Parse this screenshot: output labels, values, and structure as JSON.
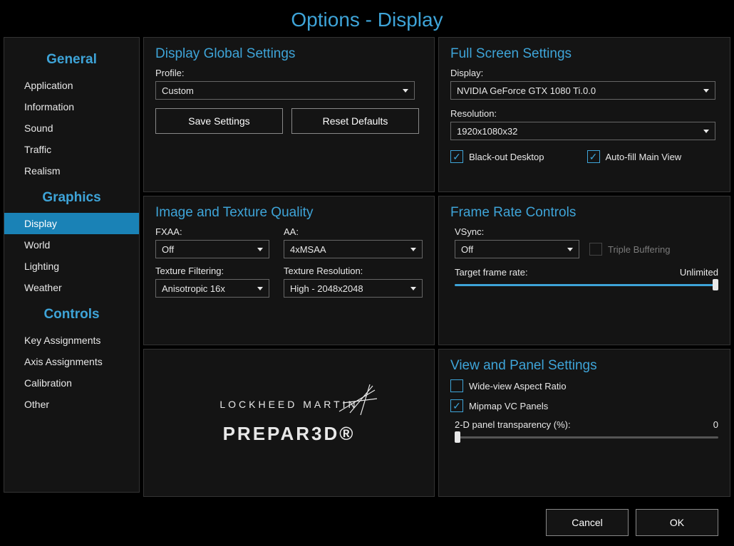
{
  "window": {
    "title": "Options - Display"
  },
  "sidebar": {
    "sections": [
      {
        "title": "General",
        "items": [
          "Application",
          "Information",
          "Sound",
          "Traffic",
          "Realism"
        ]
      },
      {
        "title": "Graphics",
        "items": [
          "Display",
          "World",
          "Lighting",
          "Weather"
        ],
        "active": "Display"
      },
      {
        "title": "Controls",
        "items": [
          "Key Assignments",
          "Axis Assignments",
          "Calibration",
          "Other"
        ]
      }
    ]
  },
  "display_global": {
    "title": "Display Global Settings",
    "profile_label": "Profile:",
    "profile_value": "Custom",
    "save_btn": "Save Settings",
    "reset_btn": "Reset Defaults"
  },
  "full_screen": {
    "title": "Full Screen Settings",
    "display_label": "Display:",
    "display_value": "NVIDIA GeForce GTX 1080 Ti.0.0",
    "resolution_label": "Resolution:",
    "resolution_value": "1920x1080x32",
    "blackout_label": "Black-out Desktop",
    "blackout_checked": true,
    "autofill_label": "Auto-fill Main View",
    "autofill_checked": true
  },
  "image_texture": {
    "title": "Image and Texture Quality",
    "fxaa_label": "FXAA:",
    "fxaa_value": "Off",
    "aa_label": "AA:",
    "aa_value": "4xMSAA",
    "filtering_label": "Texture Filtering:",
    "filtering_value": "Anisotropic 16x",
    "texres_label": "Texture Resolution:",
    "texres_value": "High - 2048x2048"
  },
  "frame_rate": {
    "title": "Frame Rate Controls",
    "vsync_label": "VSync:",
    "vsync_value": "Off",
    "triple_label": "Triple Buffering",
    "triple_checked": false,
    "target_label": "Target frame rate:",
    "target_value": "Unlimited",
    "target_slider_pct": 100
  },
  "logo": {
    "brand1": "LOCKHEED MARTIN",
    "brand2": "PREPAR3D®"
  },
  "view_panel": {
    "title": "View and Panel Settings",
    "wideview_label": "Wide-view Aspect Ratio",
    "wideview_checked": false,
    "mipmap_label": "Mipmap VC Panels",
    "mipmap_checked": true,
    "transparency_label": "2-D panel transparency (%):",
    "transparency_value": "0",
    "transparency_slider_pct": 0
  },
  "footer": {
    "cancel": "Cancel",
    "ok": "OK"
  }
}
